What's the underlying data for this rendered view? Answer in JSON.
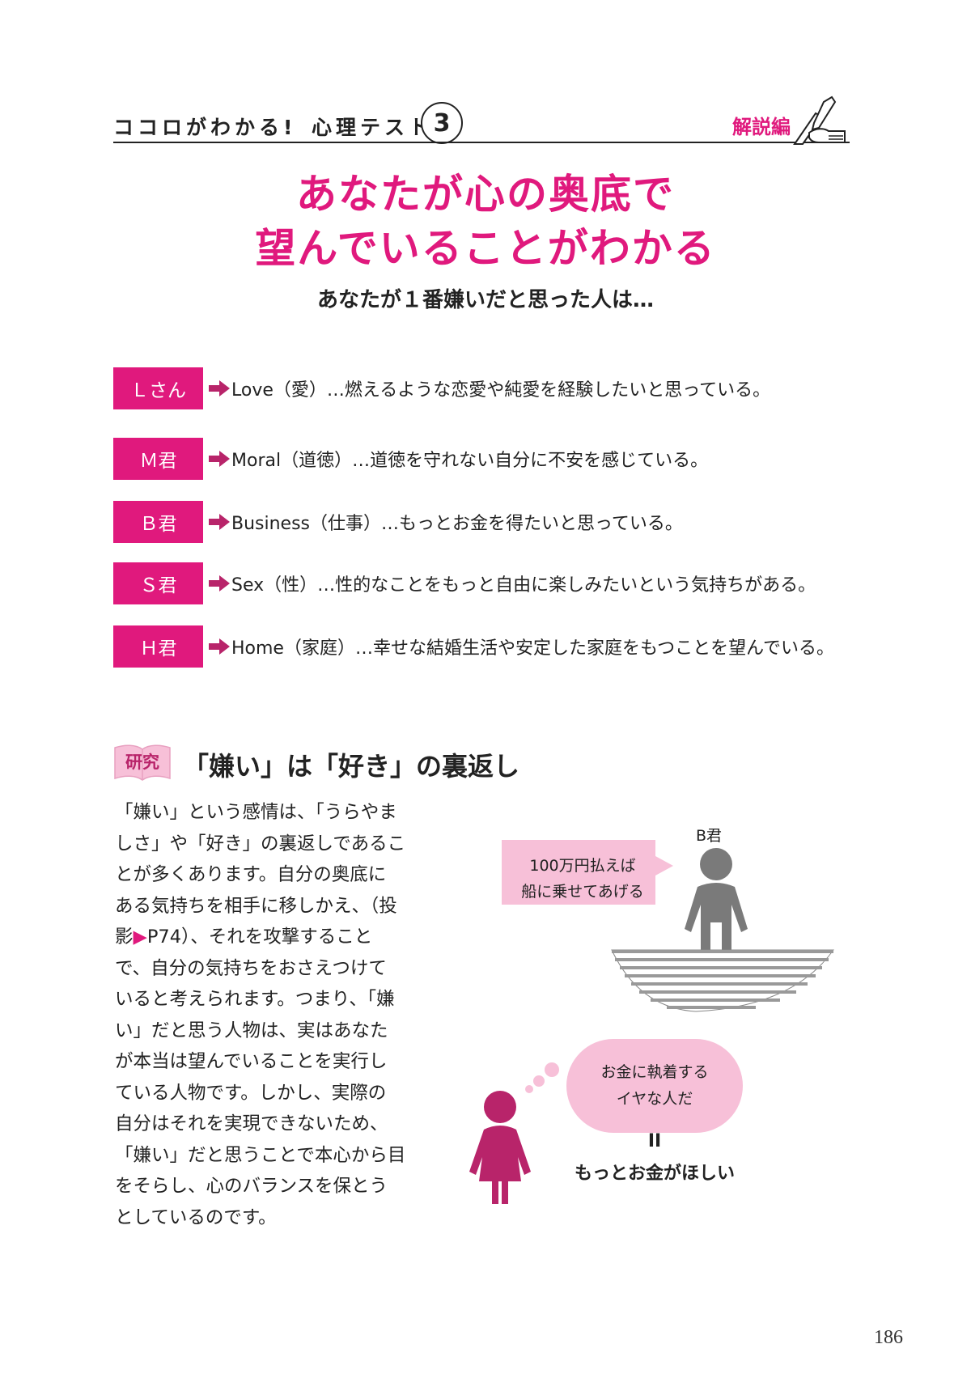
{
  "header": {
    "series_title": "ココロがわかる!",
    "test_label": "心理テスト",
    "test_number": "3",
    "section_label": "解説編"
  },
  "title": {
    "line1": "あなたが心の奥底で",
    "line2": "望んでいることがわかる"
  },
  "subtitle": "あなたが１番嫌いだと思った人は…",
  "results": [
    {
      "tag": "Ｌさん",
      "text": "Love（愛）…燃えるような恋愛や純愛を経験したいと思っている。"
    },
    {
      "tag": "Ｍ君",
      "text": "Moral（道徳）…道徳を守れない自分に不安を感じている。"
    },
    {
      "tag": "Ｂ君",
      "text": "Business（仕事）…もっとお金を得たいと思っている。"
    },
    {
      "tag": "Ｓ君",
      "text": "Sex（性）…性的なことをもっと自由に楽しみたいという気持ちがある。"
    },
    {
      "tag": "Ｈ君",
      "text": "Home（家庭）…幸せな結婚生活や安定した家庭をもつことを望んでいる。"
    }
  ],
  "research": {
    "badge": "研究",
    "heading": "「嫌い」は「好き」の裏返し",
    "body_lines": [
      "「嫌い」という感情は、「うらやま",
      "しさ」や「好き」の裏返しであるこ",
      "とが多くあります。自分の奥底に",
      "ある気持ちを相手に移しかえ、（投",
      "影",
      "P74）、それを攻撃すること",
      "で、自分の気持ちをおさえつけて",
      "いると考えられます。つまり、「嫌",
      "い」だと思う人物は、実はあなた",
      "が本当は望んでいることを実行し",
      "ている人物です。しかし、実際の",
      "自分はそれを実現できないため、",
      "「嫌い」だと思うことで本心から目",
      "をそらし、心のバランスを保とう",
      "としているのです。"
    ],
    "ref_marker": "▶"
  },
  "illustration": {
    "person_label": "B君",
    "speech_line1": "100万円払えば",
    "speech_line2": "船に乗せてあげる",
    "thought_line1": "お金に執着する",
    "thought_line2": "イヤな人だ",
    "equals": "II",
    "conclusion": "もっとお金がほしい"
  },
  "page_number": "186",
  "colors": {
    "accent": "#e0197d",
    "light_pink": "#f7c0d8",
    "figure_gray": "#7a7a7a",
    "figure_magenta": "#b8246a"
  }
}
